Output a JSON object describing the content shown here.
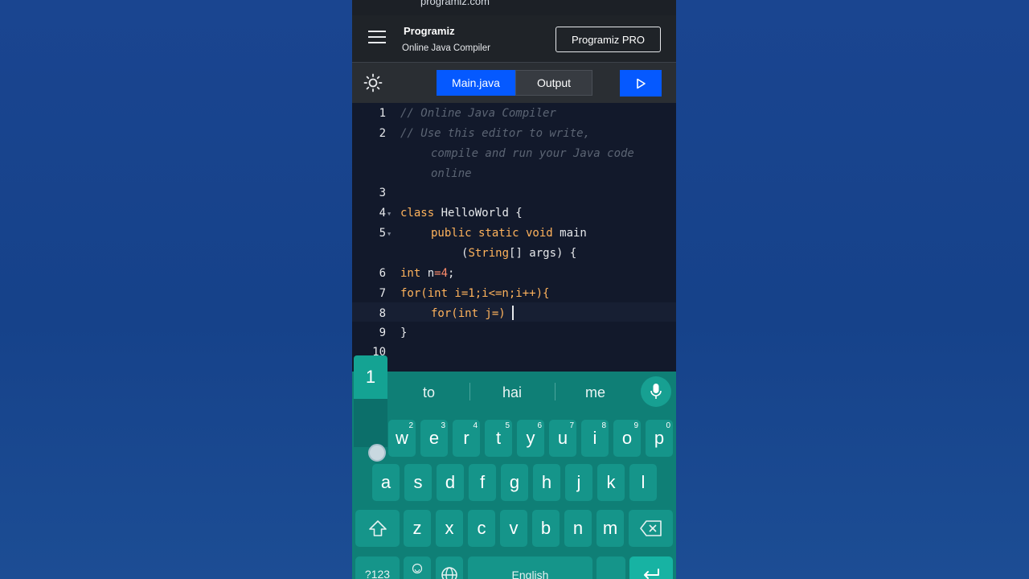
{
  "browser": {
    "url": "programiz.com"
  },
  "header": {
    "logo_mark": "P",
    "logo_text": "rogramiz",
    "subtitle": "Online Java Compiler",
    "pro_button": "Programiz PRO",
    "menu_icon": "hamburger-icon"
  },
  "toolbar": {
    "theme_icon": "sun-icon",
    "tabs": [
      {
        "label": "Main.java",
        "active": true
      },
      {
        "label": "Output",
        "active": false
      }
    ],
    "run_icon": "play-icon",
    "accent": "#0559ff"
  },
  "editor": {
    "line_numbers": [
      "1",
      "2",
      "3",
      "4",
      "5",
      "6",
      "7",
      "8",
      "9",
      "10"
    ],
    "l1": "// Online Java Compiler",
    "l2a": "// Use this editor to write,",
    "l2b": "compile and run your Java code",
    "l2c": "online",
    "l4_kw": "class",
    "l4_rest": " HelloWorld {",
    "l5_kw": "public static void",
    "l5_rest": " main",
    "l5b_open": "(",
    "l5b_type": "String",
    "l5b_rest": "[] args) {",
    "l6_kw": "int",
    "l6_var": " n",
    "l6_op": "=",
    "l6_num": "4",
    "l6_end": ";",
    "l7": "for(int i=1;i<=n;i++){",
    "l8": "for(int j=)",
    "l9": "}"
  },
  "keyboard": {
    "number_hint": "1",
    "suggestions": [
      "to",
      "hai",
      "me"
    ],
    "mic_icon": "microphone-icon",
    "row1": [
      {
        "k": "w",
        "n": "2"
      },
      {
        "k": "e",
        "n": "3"
      },
      {
        "k": "r",
        "n": "4"
      },
      {
        "k": "t",
        "n": "5"
      },
      {
        "k": "y",
        "n": "6"
      },
      {
        "k": "u",
        "n": "7"
      },
      {
        "k": "i",
        "n": "8"
      },
      {
        "k": "o",
        "n": "9"
      },
      {
        "k": "p",
        "n": "0"
      }
    ],
    "row2": [
      "a",
      "s",
      "d",
      "f",
      "g",
      "h",
      "j",
      "k",
      "l"
    ],
    "row3": [
      "z",
      "x",
      "c",
      "v",
      "b",
      "n",
      "m"
    ],
    "symbols_key": "?123",
    "emoji_icon": "emoji-icon",
    "globe_icon": "globe-icon",
    "space_label": "English",
    "shift_icon": "shift-icon",
    "backspace_icon": "backspace-icon",
    "enter_icon": "enter-icon",
    "colors": {
      "background": "#0f7f76",
      "key": "#15958a"
    }
  }
}
